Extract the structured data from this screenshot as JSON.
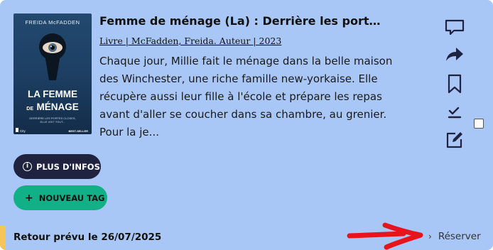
{
  "book": {
    "cover": {
      "author": "FREIDA McFADDEN",
      "title_line1": "LA FEMME",
      "title_line2_small": "DE",
      "title_line2_big": "MÉNAGE",
      "tagline_line1": "DERRIÈRE LES PORTES CLOSES,",
      "tagline_line2": "ELLE VOIT TOUT...",
      "publisher": "City",
      "badge": "BEST-SELLER"
    },
    "title": "Femme de ménage (La) : Derrière les portes, e...",
    "meta": "Livre | McFadden, Freida. Auteur | 2023",
    "description": "Chaque jour, Millie fait le ménage dans la belle maison des Winchester, une riche famille new-yorkaise. Elle récupère aussi leur fille à l'école et prépare les repas avant d'aller se coucher dans sa chambre, au grenier. Pour la je..."
  },
  "actions": {
    "more_info_label": "PLUS D'INFOS",
    "more_info_icon": "info-icon",
    "new_tag_label": "NOUVEAU TAG",
    "new_tag_icon": "plus-icon"
  },
  "side_icons": [
    "comment-icon",
    "share-icon",
    "bookmark-icon",
    "checklist-icon",
    "edit-icon"
  ],
  "footer": {
    "return_text": "Retour prévu le 26/07/2025",
    "reserve_label": "Réserver"
  },
  "colors": {
    "card_bg": "#a9c7f6",
    "dark_button": "#1f2340",
    "green_button": "#12b086",
    "icon_color": "#1f2340",
    "annotation_arrow": "#e8141c",
    "footer_accent": "#f5c55a"
  }
}
